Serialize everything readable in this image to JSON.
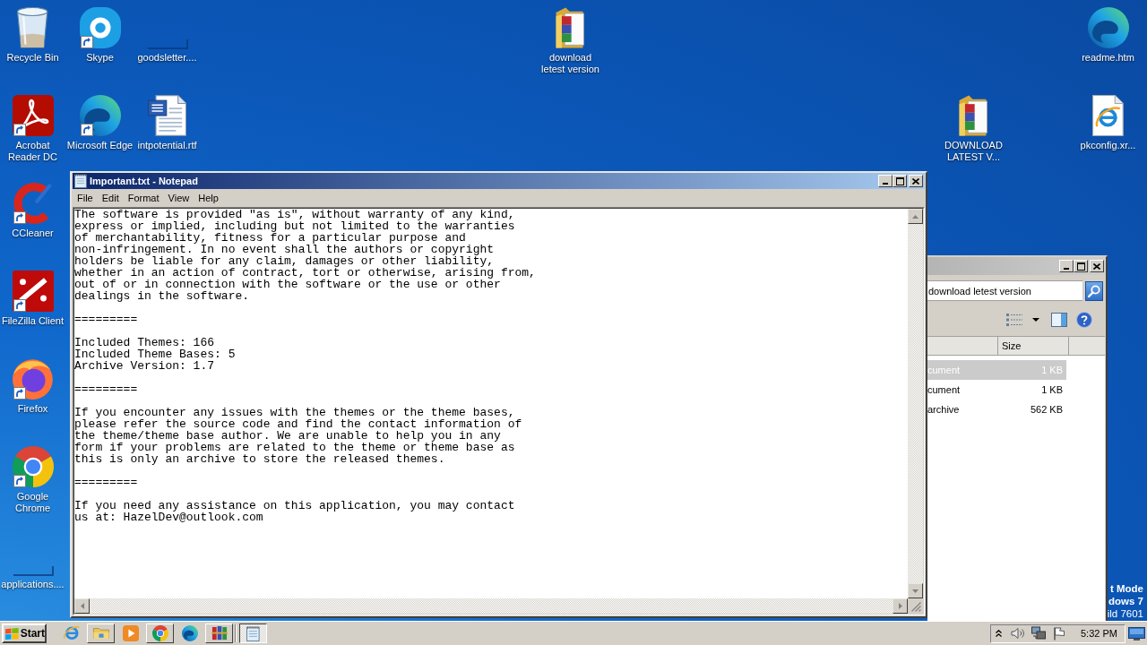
{
  "desktop_icons": [
    {
      "kind": "trash",
      "label": [
        "Recycle Bin"
      ],
      "shortcut": false
    },
    {
      "kind": "skype",
      "label": [
        "Skype"
      ],
      "shortcut": true
    },
    {
      "kind": "blank",
      "label": [
        "goodsletter...."
      ],
      "shortcut": false
    },
    {
      "kind": "rarfolder",
      "label": [
        "download",
        "letest version"
      ],
      "shortcut": false
    },
    {
      "kind": "edge",
      "label": [
        "readme.htm"
      ],
      "shortcut": false
    },
    {
      "kind": "acrobat",
      "label": [
        "Acrobat",
        "Reader DC"
      ],
      "shortcut": true
    },
    {
      "kind": "edge",
      "label": [
        "Microsoft Edge"
      ],
      "shortcut": true
    },
    {
      "kind": "word",
      "label": [
        "intpotential.rtf"
      ],
      "shortcut": false
    },
    {
      "kind": "rarfolder",
      "label": [
        "DOWNLOAD",
        "LATEST V..."
      ],
      "shortcut": false
    },
    {
      "kind": "iepage",
      "label": [
        "pkconfig.xr..."
      ],
      "shortcut": false
    },
    {
      "kind": "ccleaner",
      "label": [
        "CCleaner"
      ],
      "shortcut": true
    },
    {
      "kind": "filezilla",
      "label": [
        "FileZilla Client"
      ],
      "shortcut": true
    },
    {
      "kind": "firefox",
      "label": [
        "Firefox"
      ],
      "shortcut": true
    },
    {
      "kind": "chrome",
      "label": [
        "Google",
        "Chrome"
      ],
      "shortcut": true
    },
    {
      "kind": "blank",
      "label": [
        "applications...."
      ],
      "shortcut": false
    }
  ],
  "notepad": {
    "title": "Important.txt - Notepad",
    "active": true,
    "menu": [
      "File",
      "Edit",
      "Format",
      "View",
      "Help"
    ],
    "paragraphs": [
      [
        "The software is provided \"as is\", without warranty of any kind,",
        "express or implied, including but not limited to the warranties",
        "of merchantability, fitness for a particular purpose and",
        "non-infringement. In no event shall the authors or copyright",
        "holders be liable for any claim, damages or other liability,",
        "whether in an action of contract, tort or otherwise, arising from,",
        "out of or in connection with the software or the use or other",
        "dealings in the software."
      ],
      [
        "========="
      ],
      [
        "Included Themes: 166",
        "Included Theme Bases: 5",
        "Archive Version: 1.7"
      ],
      [
        "========="
      ],
      [
        "If you encounter any issues with the themes or the theme bases,",
        "please refer the source code and find the contact information of",
        "the theme/theme base author. We are unable to help you in any",
        "form if your problems are related to the theme or theme base as",
        "this is only an archive to store the released themes."
      ],
      [
        "========="
      ],
      [
        "If you need any assistance on this application, you may contact",
        "us at: HazelDev@outlook.com"
      ]
    ]
  },
  "explorer": {
    "active": false,
    "search": {
      "value": "download letest version"
    },
    "columns": [
      {
        "label": "Size"
      }
    ],
    "rows": [
      {
        "column_1": "cument",
        "size": "1 KB",
        "selected": true
      },
      {
        "column_1": "cument",
        "size": "1 KB",
        "selected": false
      },
      {
        "column_1": "archive",
        "size": "562 KB",
        "selected": false
      }
    ]
  },
  "desktop_notice": [
    {
      "text": "t Mode",
      "bold": true
    },
    {
      "text": "dows 7",
      "bold": true
    },
    {
      "text": "ild 7601",
      "bold": false
    }
  ],
  "taskbar": {
    "start_label": "Start",
    "quick_launch": [
      {
        "kind": "ie",
        "open": false
      },
      {
        "kind": "folder",
        "open": true
      },
      {
        "kind": "media",
        "open": false
      },
      {
        "kind": "chrome",
        "open": true
      },
      {
        "kind": "edge",
        "open": false
      },
      {
        "kind": "winrar",
        "open": true
      }
    ],
    "tasks": [
      {
        "kind": "notepad",
        "selected": true
      }
    ],
    "clock": "5:32 PM"
  }
}
